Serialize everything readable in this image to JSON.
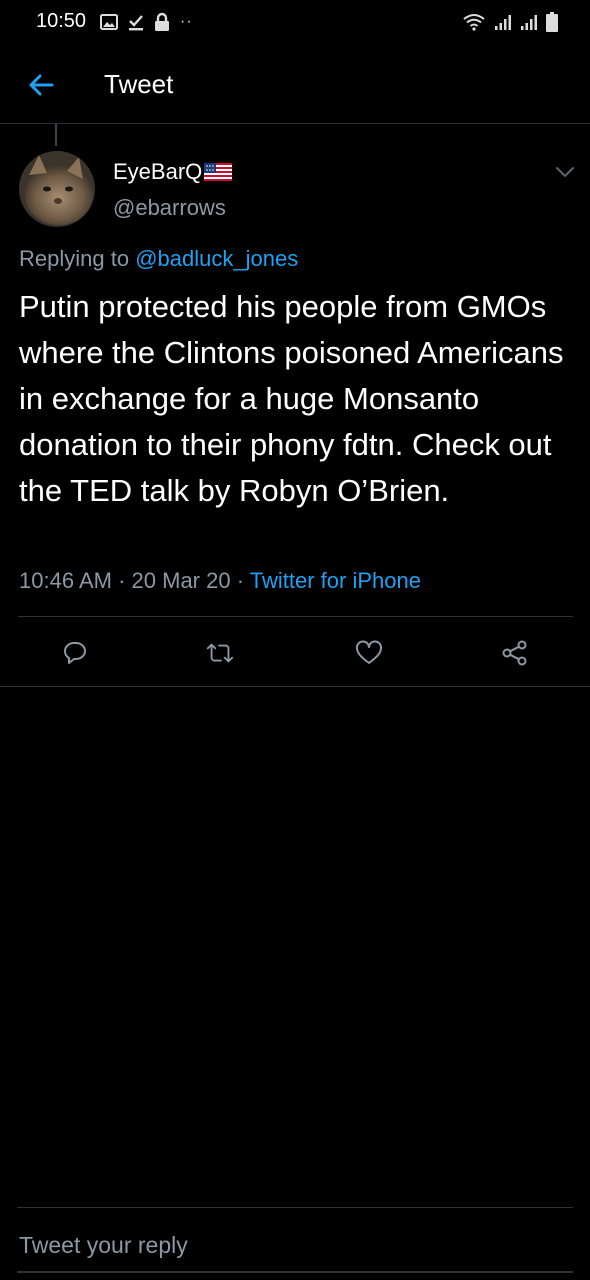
{
  "status_bar": {
    "time": "10:50"
  },
  "header": {
    "title": "Tweet"
  },
  "tweet": {
    "display_name": "EyeBarQ",
    "handle": "@ebarrows",
    "replying_prefix": "Replying to",
    "replying_to": "@badluck_jones",
    "text": "Putin protected his people from GMOs where the Clintons poisoned Americans in exchange for a huge Monsanto donation to their phony fdtn. Check out the TED talk by Robyn O’Brien.",
    "time": "10:46 AM",
    "separator": "·",
    "date": "20 Mar 20",
    "source": "Twitter for iPhone"
  },
  "actions": [
    "reply-icon",
    "retweet-icon",
    "like-icon",
    "share-icon"
  ],
  "reply_box": {
    "placeholder": "Tweet your reply"
  },
  "colors": {
    "accent": "#1da1f2",
    "muted": "#8b98a5",
    "divider": "#2f3336",
    "background": "#000000"
  }
}
